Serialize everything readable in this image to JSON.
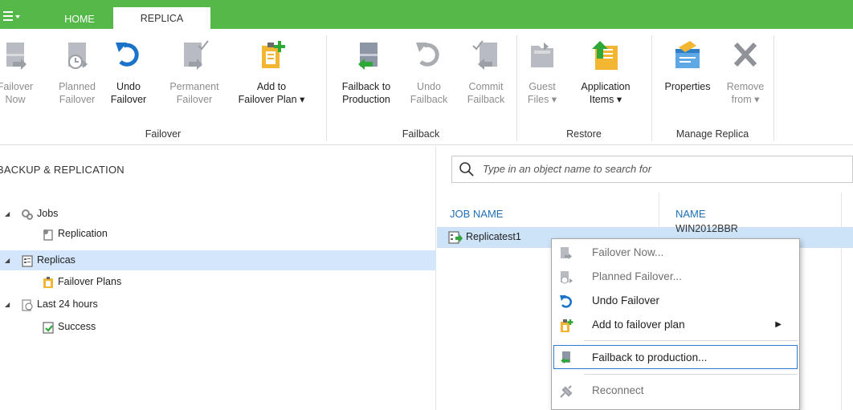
{
  "app": {
    "menu_icon": "hamburger-menu-icon",
    "tabs": [
      "HOME",
      "REPLICA"
    ]
  },
  "ribbon": {
    "failover_group": {
      "label": "Failover",
      "buttons": [
        {
          "line1": "Failover",
          "line2": "Now",
          "icon": "failover-now-icon"
        },
        {
          "line1": "Planned",
          "line2": "Failover",
          "icon": "planned-failover-icon"
        },
        {
          "line1": "Undo",
          "line2": "Failover",
          "icon": "undo-failover-icon"
        },
        {
          "line1": "Permanent",
          "line2": "Failover",
          "icon": "permanent-failover-icon"
        },
        {
          "line1": "Add to",
          "line2": "Failover Plan ▾",
          "icon": "add-to-plan-icon"
        }
      ]
    },
    "failback_group": {
      "label": "Failback",
      "buttons": [
        {
          "line1": "Failback to",
          "line2": "Production",
          "icon": "failback-to-production-icon"
        },
        {
          "line1": "Undo",
          "line2": "Failback",
          "icon": "undo-failback-icon"
        },
        {
          "line1": "Commit",
          "line2": "Failback",
          "icon": "commit-failback-icon"
        }
      ]
    },
    "restore_group": {
      "label": "Restore",
      "buttons": [
        {
          "line1": "Guest",
          "line2": "Files ▾",
          "icon": "guest-files-icon"
        },
        {
          "line1": "Application",
          "line2": "Items ▾",
          "icon": "application-items-icon"
        }
      ]
    },
    "manage_group": {
      "label": "Manage Replica",
      "buttons": [
        {
          "line1": "Properties",
          "line2": "",
          "icon": "properties-icon"
        },
        {
          "line1": "Remove",
          "line2": "from ▾",
          "icon": "remove-icon"
        }
      ]
    }
  },
  "left_panel": {
    "title": "BACKUP & REPLICATION",
    "tree": [
      {
        "label": "Jobs",
        "icon": "jobs-icon"
      },
      {
        "label": "Replication",
        "icon": "replication-icon"
      },
      {
        "label": "Replicas",
        "icon": "replicas-icon"
      },
      {
        "label": "Failover Plans",
        "icon": "failover-plans-icon"
      },
      {
        "label": "Last 24 hours",
        "icon": "last-24-hours-icon"
      },
      {
        "label": "Success",
        "icon": "success-icon"
      }
    ]
  },
  "right_panel": {
    "search_placeholder": "Type in an object name to search for",
    "columns": [
      "JOB NAME",
      "NAME"
    ],
    "rows": [
      {
        "job_name": "Replicatest1",
        "name": "WIN2012BBR"
      }
    ]
  },
  "context_menu": {
    "items": [
      {
        "label": "Failover Now...",
        "icon": "failover-now-icon"
      },
      {
        "label": "Planned Failover...",
        "icon": "planned-failover-icon"
      },
      {
        "label": "Undo Failover",
        "icon": "undo-failover-icon"
      },
      {
        "label": "Add to failover plan",
        "icon": "add-to-plan-icon",
        "submenu_arrow": "▶"
      },
      {
        "label": "Failback to production...",
        "icon": "failback-to-production-icon"
      },
      {
        "label": "Reconnect",
        "icon": "reconnect-icon"
      }
    ]
  },
  "colors": {
    "brand_green": "#54b948",
    "selection_blue": "#cde3f7",
    "link_blue": "#1f6fb5",
    "undo_blue": "#1a73c9"
  }
}
